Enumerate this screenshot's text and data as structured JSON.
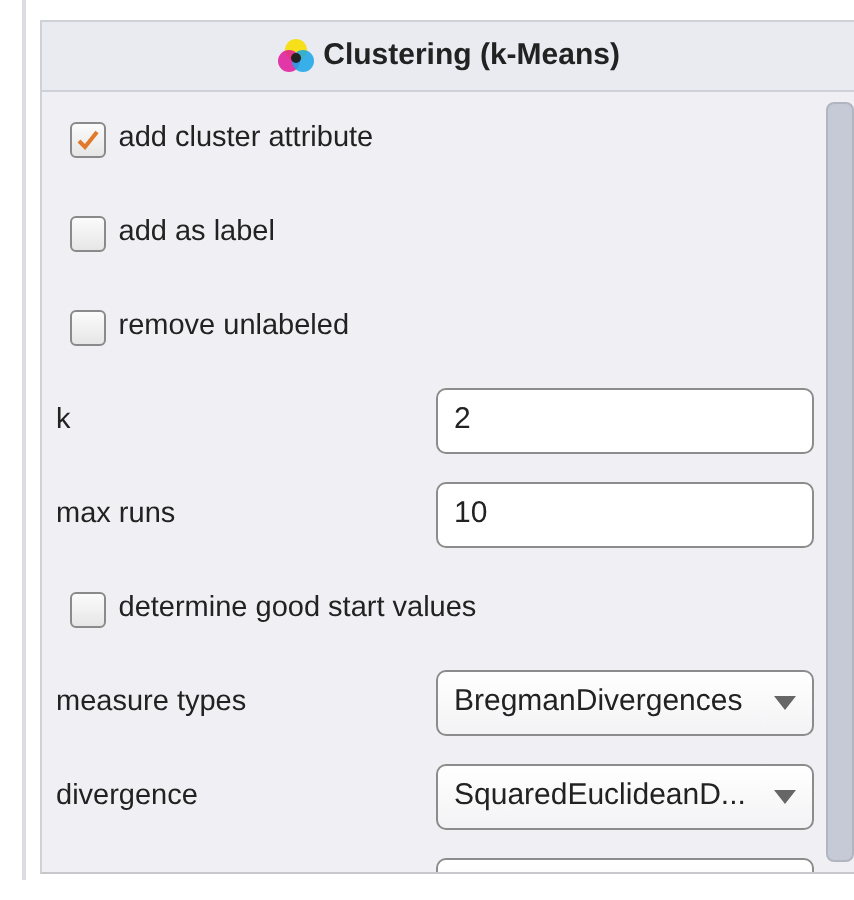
{
  "panel": {
    "title": "Clustering (k-Means)"
  },
  "parameters": [
    {
      "kind": "checkbox",
      "label": "add cluster attribute",
      "checked": true
    },
    {
      "kind": "checkbox",
      "label": "add as label",
      "checked": false
    },
    {
      "kind": "checkbox",
      "label": "remove unlabeled",
      "checked": false
    },
    {
      "kind": "text",
      "label": "k",
      "value": "2"
    },
    {
      "kind": "text",
      "label": "max runs",
      "value": "10"
    },
    {
      "kind": "checkbox",
      "label": "determine good start values",
      "checked": false
    },
    {
      "kind": "select",
      "label": "measure types",
      "value": "BregmanDivergences"
    },
    {
      "kind": "select",
      "label": "divergence",
      "value": "SquaredEuclideanD..."
    },
    {
      "kind": "select"
    }
  ]
}
